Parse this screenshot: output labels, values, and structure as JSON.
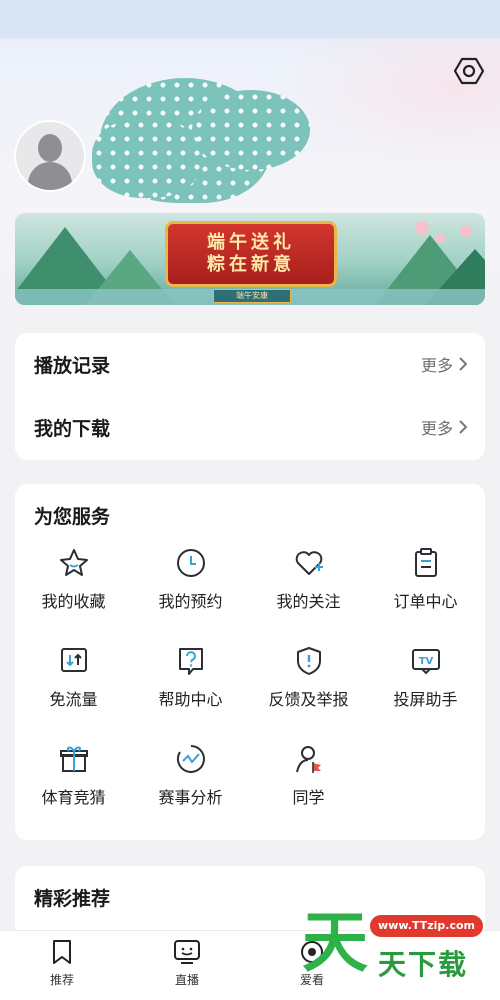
{
  "records_card": {
    "play_history": {
      "title": "播放记录",
      "more": "更多"
    },
    "downloads": {
      "title": "我的下载",
      "more": "更多"
    }
  },
  "services": {
    "title": "为您服务",
    "items": [
      {
        "label": "我的收藏",
        "icon": "star-icon"
      },
      {
        "label": "我的预约",
        "icon": "clock-icon"
      },
      {
        "label": "我的关注",
        "icon": "heart-plus-icon"
      },
      {
        "label": "订单中心",
        "icon": "clipboard-icon"
      },
      {
        "label": "免流量",
        "icon": "data-free-icon"
      },
      {
        "label": "帮助中心",
        "icon": "help-icon"
      },
      {
        "label": "反馈及举报",
        "icon": "shield-alert-icon"
      },
      {
        "label": "投屏助手",
        "icon": "tv-cast-icon"
      },
      {
        "label": "体育竞猜",
        "icon": "gift-icon"
      },
      {
        "label": "赛事分析",
        "icon": "analysis-icon"
      },
      {
        "label": "同学",
        "icon": "classmate-icon"
      }
    ]
  },
  "featured": {
    "title": "精彩推荐"
  },
  "tabbar": {
    "items": [
      {
        "label": "推荐",
        "icon": "bookmark-icon"
      },
      {
        "label": "直播",
        "icon": "live-tv-icon"
      },
      {
        "label": "爱看",
        "icon": "eye-icon"
      }
    ]
  },
  "banner": {
    "line1": "端午送礼",
    "line2": "粽在新意",
    "sub": "端午安康"
  },
  "watermark": {
    "char": "天",
    "url": "www.TTzip.com",
    "text": "天下载"
  },
  "colors": {
    "accent_green": "#2fb14a",
    "watermark_red": "#e2392e",
    "banner_red": "#c62b25"
  }
}
